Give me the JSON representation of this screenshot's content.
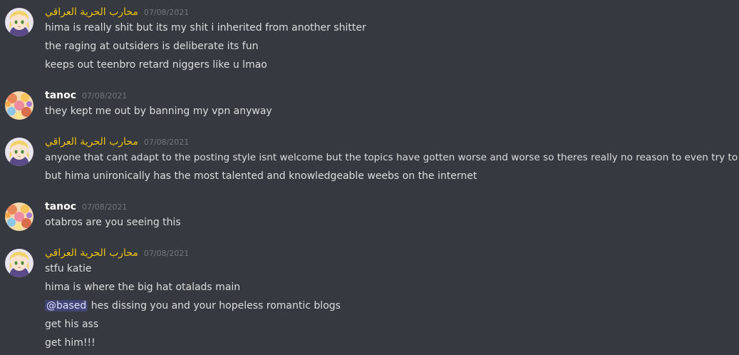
{
  "messages": [
    {
      "author": "محارب الحرية العراقي",
      "author_color": "#f1c40f",
      "avatar": "anime-girl-blonde-avatar",
      "timestamp": "07/08/2021",
      "lines": [
        "hima is really shit but its my shit i inherited from another shitter",
        "the raging at outsiders is deliberate its fun",
        "keeps out teenbro retard niggers like u lmao"
      ]
    },
    {
      "author": "tanoc",
      "author_color": "#ffffff",
      "avatar": "colorful-collage-avatar",
      "timestamp": "07/08/2021",
      "lines": [
        "they kept me out by banning my vpn anyway"
      ]
    },
    {
      "author": "محارب الحرية العراقي",
      "author_color": "#f1c40f",
      "avatar": "anime-girl-blonde-avatar",
      "timestamp": "07/08/2021",
      "lines": [
        "anyone that cant adapt to the posting style isnt welcome but the topics have gotten worse and worse so theres really no reason to even try to fit in",
        "but hima unironically has the most talented and knowledgeable weebs on the internet"
      ]
    },
    {
      "author": "tanoc",
      "author_color": "#ffffff",
      "avatar": "colorful-collage-avatar",
      "timestamp": "07/08/2021",
      "lines": [
        "otabros are you seeing this"
      ]
    },
    {
      "author": "محارب الحرية العراقي",
      "author_color": "#f1c40f",
      "avatar": "anime-girl-blonde-avatar",
      "timestamp": "07/08/2021",
      "lines": [
        "stfu katie",
        "hima is where the big hat otalads main",
        "hes dissing you and your hopeless romantic blogs",
        "get his ass",
        "get him!!!"
      ],
      "mention": "@based"
    }
  ]
}
